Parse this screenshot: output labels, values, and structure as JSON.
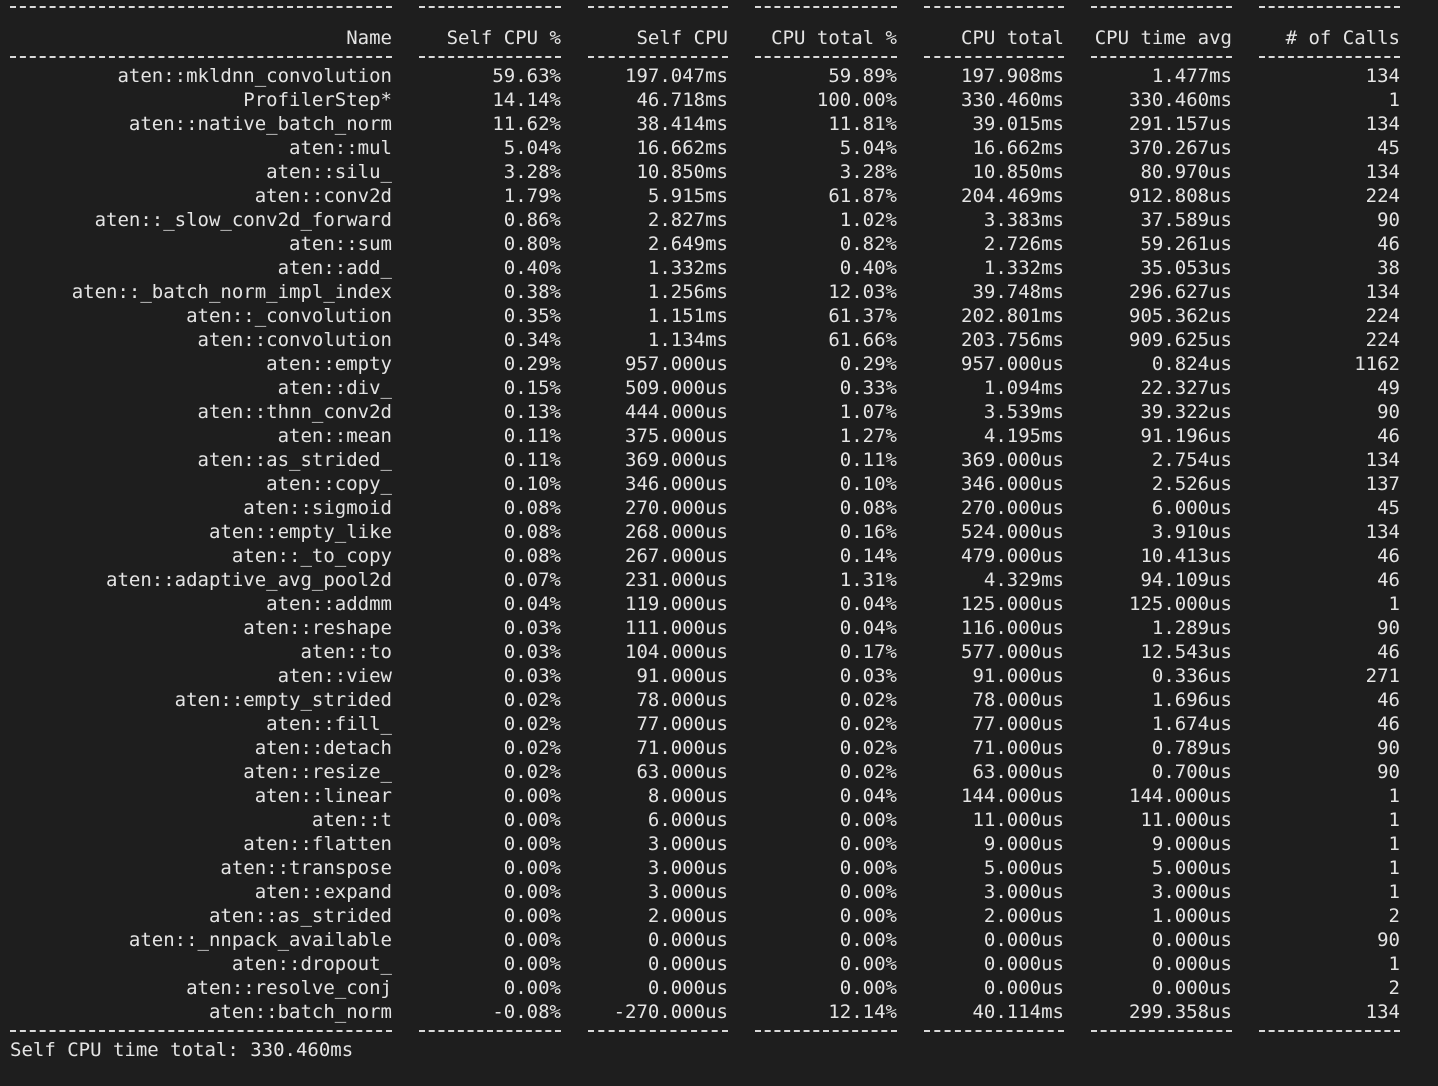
{
  "columns": [
    "Name",
    "Self CPU %",
    "Self CPU",
    "CPU total %",
    "CPU total",
    "CPU time avg",
    "# of Calls"
  ],
  "rows": [
    [
      "aten::mkldnn_convolution",
      "59.63%",
      "197.047ms",
      "59.89%",
      "197.908ms",
      "1.477ms",
      "134"
    ],
    [
      "ProfilerStep*",
      "14.14%",
      "46.718ms",
      "100.00%",
      "330.460ms",
      "330.460ms",
      "1"
    ],
    [
      "aten::native_batch_norm",
      "11.62%",
      "38.414ms",
      "11.81%",
      "39.015ms",
      "291.157us",
      "134"
    ],
    [
      "aten::mul",
      "5.04%",
      "16.662ms",
      "5.04%",
      "16.662ms",
      "370.267us",
      "45"
    ],
    [
      "aten::silu_",
      "3.28%",
      "10.850ms",
      "3.28%",
      "10.850ms",
      "80.970us",
      "134"
    ],
    [
      "aten::conv2d",
      "1.79%",
      "5.915ms",
      "61.87%",
      "204.469ms",
      "912.808us",
      "224"
    ],
    [
      "aten::_slow_conv2d_forward",
      "0.86%",
      "2.827ms",
      "1.02%",
      "3.383ms",
      "37.589us",
      "90"
    ],
    [
      "aten::sum",
      "0.80%",
      "2.649ms",
      "0.82%",
      "2.726ms",
      "59.261us",
      "46"
    ],
    [
      "aten::add_",
      "0.40%",
      "1.332ms",
      "0.40%",
      "1.332ms",
      "35.053us",
      "38"
    ],
    [
      "aten::_batch_norm_impl_index",
      "0.38%",
      "1.256ms",
      "12.03%",
      "39.748ms",
      "296.627us",
      "134"
    ],
    [
      "aten::_convolution",
      "0.35%",
      "1.151ms",
      "61.37%",
      "202.801ms",
      "905.362us",
      "224"
    ],
    [
      "aten::convolution",
      "0.34%",
      "1.134ms",
      "61.66%",
      "203.756ms",
      "909.625us",
      "224"
    ],
    [
      "aten::empty",
      "0.29%",
      "957.000us",
      "0.29%",
      "957.000us",
      "0.824us",
      "1162"
    ],
    [
      "aten::div_",
      "0.15%",
      "509.000us",
      "0.33%",
      "1.094ms",
      "22.327us",
      "49"
    ],
    [
      "aten::thnn_conv2d",
      "0.13%",
      "444.000us",
      "1.07%",
      "3.539ms",
      "39.322us",
      "90"
    ],
    [
      "aten::mean",
      "0.11%",
      "375.000us",
      "1.27%",
      "4.195ms",
      "91.196us",
      "46"
    ],
    [
      "aten::as_strided_",
      "0.11%",
      "369.000us",
      "0.11%",
      "369.000us",
      "2.754us",
      "134"
    ],
    [
      "aten::copy_",
      "0.10%",
      "346.000us",
      "0.10%",
      "346.000us",
      "2.526us",
      "137"
    ],
    [
      "aten::sigmoid",
      "0.08%",
      "270.000us",
      "0.08%",
      "270.000us",
      "6.000us",
      "45"
    ],
    [
      "aten::empty_like",
      "0.08%",
      "268.000us",
      "0.16%",
      "524.000us",
      "3.910us",
      "134"
    ],
    [
      "aten::_to_copy",
      "0.08%",
      "267.000us",
      "0.14%",
      "479.000us",
      "10.413us",
      "46"
    ],
    [
      "aten::adaptive_avg_pool2d",
      "0.07%",
      "231.000us",
      "1.31%",
      "4.329ms",
      "94.109us",
      "46"
    ],
    [
      "aten::addmm",
      "0.04%",
      "119.000us",
      "0.04%",
      "125.000us",
      "125.000us",
      "1"
    ],
    [
      "aten::reshape",
      "0.03%",
      "111.000us",
      "0.04%",
      "116.000us",
      "1.289us",
      "90"
    ],
    [
      "aten::to",
      "0.03%",
      "104.000us",
      "0.17%",
      "577.000us",
      "12.543us",
      "46"
    ],
    [
      "aten::view",
      "0.03%",
      "91.000us",
      "0.03%",
      "91.000us",
      "0.336us",
      "271"
    ],
    [
      "aten::empty_strided",
      "0.02%",
      "78.000us",
      "0.02%",
      "78.000us",
      "1.696us",
      "46"
    ],
    [
      "aten::fill_",
      "0.02%",
      "77.000us",
      "0.02%",
      "77.000us",
      "1.674us",
      "46"
    ],
    [
      "aten::detach",
      "0.02%",
      "71.000us",
      "0.02%",
      "71.000us",
      "0.789us",
      "90"
    ],
    [
      "aten::resize_",
      "0.02%",
      "63.000us",
      "0.02%",
      "63.000us",
      "0.700us",
      "90"
    ],
    [
      "aten::linear",
      "0.00%",
      "8.000us",
      "0.04%",
      "144.000us",
      "144.000us",
      "1"
    ],
    [
      "aten::t",
      "0.00%",
      "6.000us",
      "0.00%",
      "11.000us",
      "11.000us",
      "1"
    ],
    [
      "aten::flatten",
      "0.00%",
      "3.000us",
      "0.00%",
      "9.000us",
      "9.000us",
      "1"
    ],
    [
      "aten::transpose",
      "0.00%",
      "3.000us",
      "0.00%",
      "5.000us",
      "5.000us",
      "1"
    ],
    [
      "aten::expand",
      "0.00%",
      "3.000us",
      "0.00%",
      "3.000us",
      "3.000us",
      "1"
    ],
    [
      "aten::as_strided",
      "0.00%",
      "2.000us",
      "0.00%",
      "2.000us",
      "1.000us",
      "2"
    ],
    [
      "aten::_nnpack_available",
      "0.00%",
      "0.000us",
      "0.00%",
      "0.000us",
      "0.000us",
      "90"
    ],
    [
      "aten::dropout_",
      "0.00%",
      "0.000us",
      "0.00%",
      "0.000us",
      "0.000us",
      "1"
    ],
    [
      "aten::resolve_conj",
      "0.00%",
      "0.000us",
      "0.00%",
      "0.000us",
      "0.000us",
      "2"
    ],
    [
      "aten::batch_norm",
      "-0.08%",
      "-270.000us",
      "12.14%",
      "40.114ms",
      "299.358us",
      "134"
    ]
  ],
  "footer": "Self CPU time total: 330.460ms"
}
